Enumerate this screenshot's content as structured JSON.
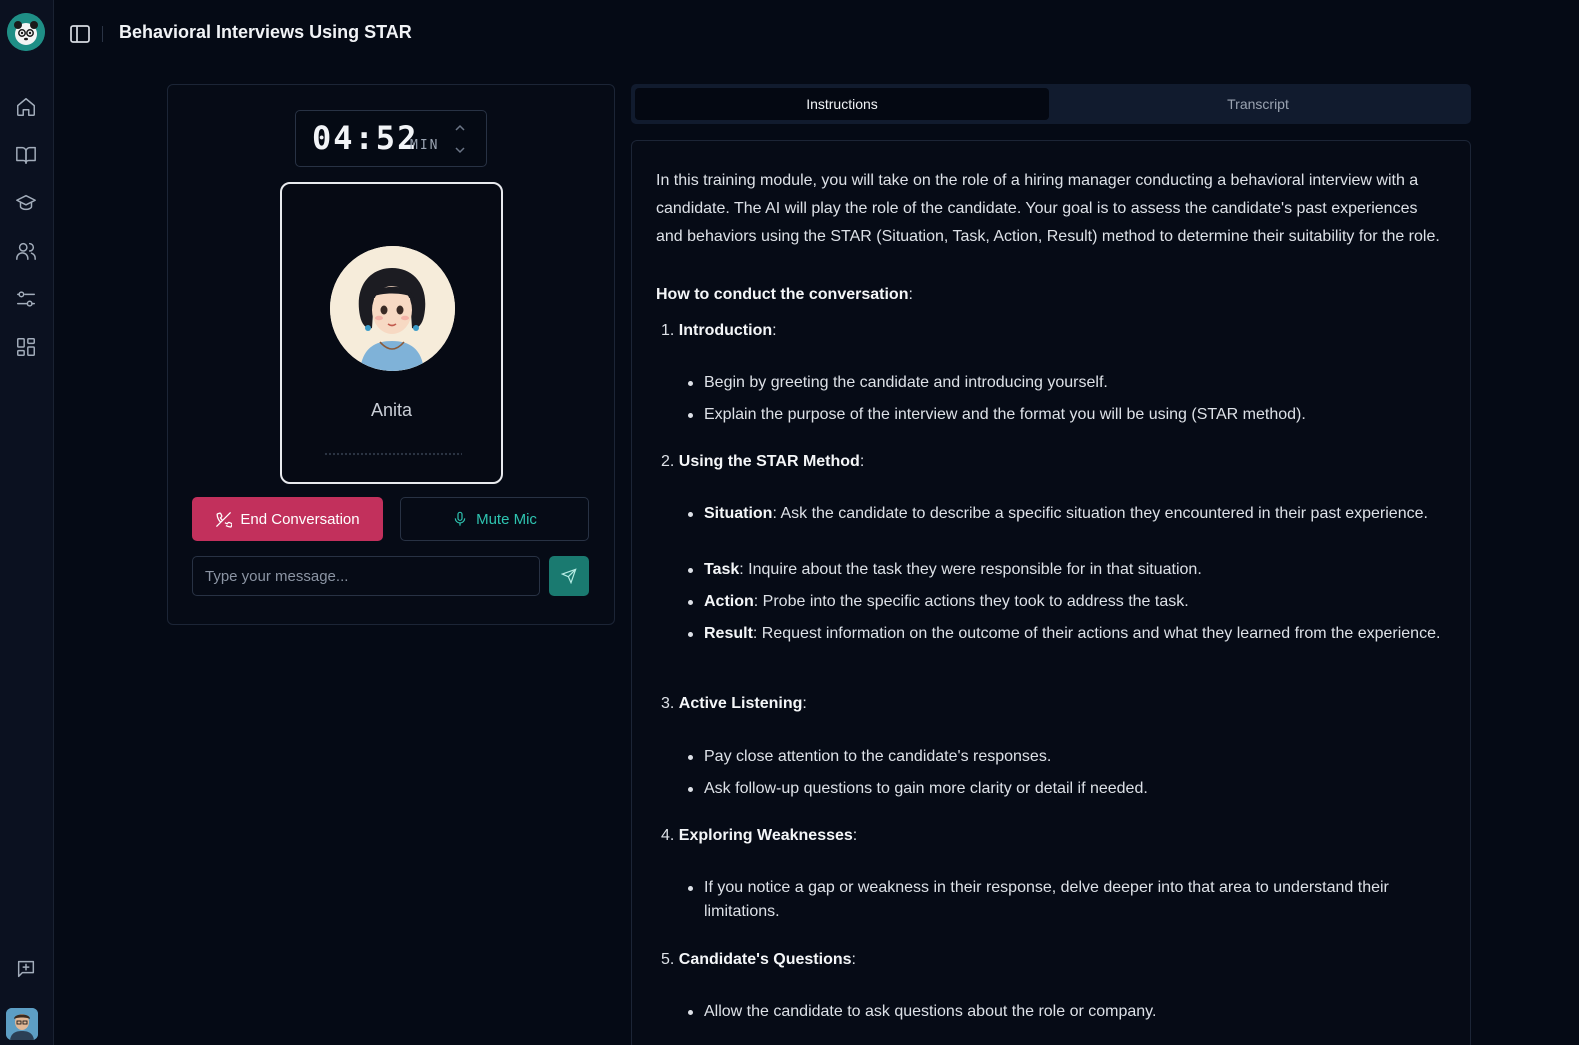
{
  "header": {
    "title": "Behavioral Interviews Using STAR"
  },
  "sidebar": {
    "items": [
      {
        "icon": "home-icon"
      },
      {
        "icon": "book-open-icon"
      },
      {
        "icon": "graduation-cap-icon"
      },
      {
        "icon": "users-icon"
      },
      {
        "icon": "sliders-icon"
      },
      {
        "icon": "layout-grid-icon"
      }
    ],
    "bottom_icons": [
      "message-plus-icon",
      "user-avatar"
    ]
  },
  "timer": {
    "value": "04:52",
    "unit": "MIN"
  },
  "agent": {
    "name": "Anita"
  },
  "controls": {
    "end_label": "End Conversation",
    "mute_label": "Mute Mic",
    "message_placeholder": "Type your message...",
    "message_value": ""
  },
  "colors": {
    "accent": "#2ec4b0",
    "end_button": "#c2305c",
    "send_button": "#1a7a70",
    "background": "#050a15"
  },
  "tabs": [
    {
      "label": "Instructions",
      "active": true
    },
    {
      "label": "Transcript",
      "active": false
    }
  ],
  "instructions": {
    "intro": "In this training module, you will take on the role of a hiring manager conducting a behavioral interview with a candidate. The AI will play the role of the candidate. Your goal is to assess the candidate's past experiences and behaviors using the STAR (Situation, Task, Action, Result) method to determine their suitability for the role.",
    "heading": "How to conduct the conversation",
    "heading_suffix": ":",
    "sections": [
      {
        "number": "1.",
        "title": "Introduction",
        "items": [
          {
            "term": "",
            "text": "Begin by greeting the candidate and introducing yourself."
          },
          {
            "term": "",
            "text": "Explain the purpose of the interview and the format you will be using (STAR method)."
          }
        ]
      },
      {
        "number": "2.",
        "title": "Using the STAR Method",
        "items": [
          {
            "term": "Situation",
            "text": ": Ask the candidate to describe a specific situation they encountered in their past experience."
          },
          {
            "term": "Task",
            "text": ": Inquire about the task they were responsible for in that situation."
          },
          {
            "term": "Action",
            "text": ": Probe into the specific actions they took to address the task."
          },
          {
            "term": "Result",
            "text": ": Request information on the outcome of their actions and what they learned from the experience."
          }
        ]
      },
      {
        "number": "3.",
        "title": "Active Listening",
        "items": [
          {
            "term": "",
            "text": "Pay close attention to the candidate's responses."
          },
          {
            "term": "",
            "text": "Ask follow-up questions to gain more clarity or detail if needed."
          }
        ]
      },
      {
        "number": "4.",
        "title": "Exploring Weaknesses",
        "items": [
          {
            "term": "",
            "text": "If you notice a gap or weakness in their response, delve deeper into that area to understand their limitations."
          }
        ]
      },
      {
        "number": "5.",
        "title": "Candidate's Questions",
        "items": [
          {
            "term": "",
            "text": "Allow the candidate to ask questions about the role or company."
          }
        ]
      }
    ]
  }
}
